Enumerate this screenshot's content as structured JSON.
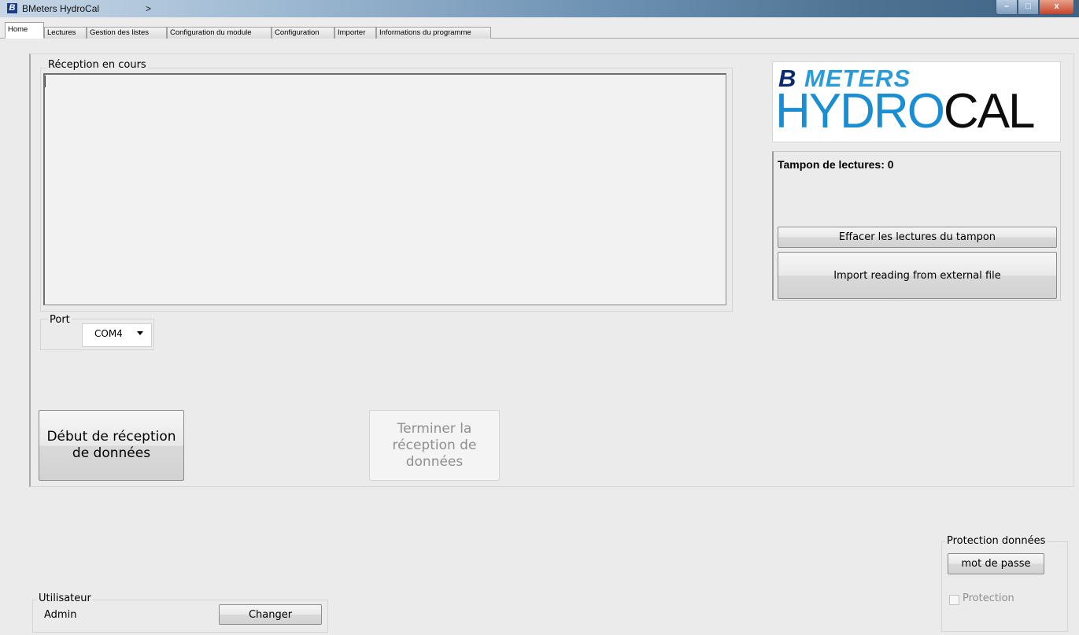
{
  "window": {
    "title": "BMeters HydroCal",
    "title_chevron": ">",
    "app_icon_letter": "B",
    "min_glyph": "–",
    "max_glyph": "□",
    "close_glyph": "x"
  },
  "tabs": [
    {
      "label": "Home",
      "active": true
    },
    {
      "label": "Lectures"
    },
    {
      "label": "Gestion des listes"
    },
    {
      "label": "Configuration du module"
    },
    {
      "label": "Configuration"
    },
    {
      "label": "Importer"
    },
    {
      "label": "Informations du programme"
    }
  ],
  "reception": {
    "group_label": "Réception en cours",
    "content": ""
  },
  "port": {
    "group_label": "Port",
    "value": "COM4"
  },
  "buttons": {
    "start_label": "Début de réception de données",
    "stop_label": "Terminer la réception de données",
    "clear_buffer_label": "Effacer les lectures du tampon",
    "import_label": "Import reading from external file",
    "password_label": "mot de passe",
    "change_user_label": "Changer"
  },
  "logo": {
    "brand_b": "B",
    "brand_meters": "METERS",
    "product_hydr": "HYDR",
    "product_o": "O",
    "product_cal": "CAL"
  },
  "buffer": {
    "title": "Tampon de lectures: 0"
  },
  "protection": {
    "group_label": "Protection données",
    "checkbox_label": "Protection",
    "checked": false
  },
  "user": {
    "group_label": "Utilisateur",
    "name": "Admin"
  },
  "colors": {
    "brand_dark_blue": "#0a2a6e",
    "brand_light_blue": "#2a9bd8",
    "hydro_blue": "#1b8ed2"
  }
}
